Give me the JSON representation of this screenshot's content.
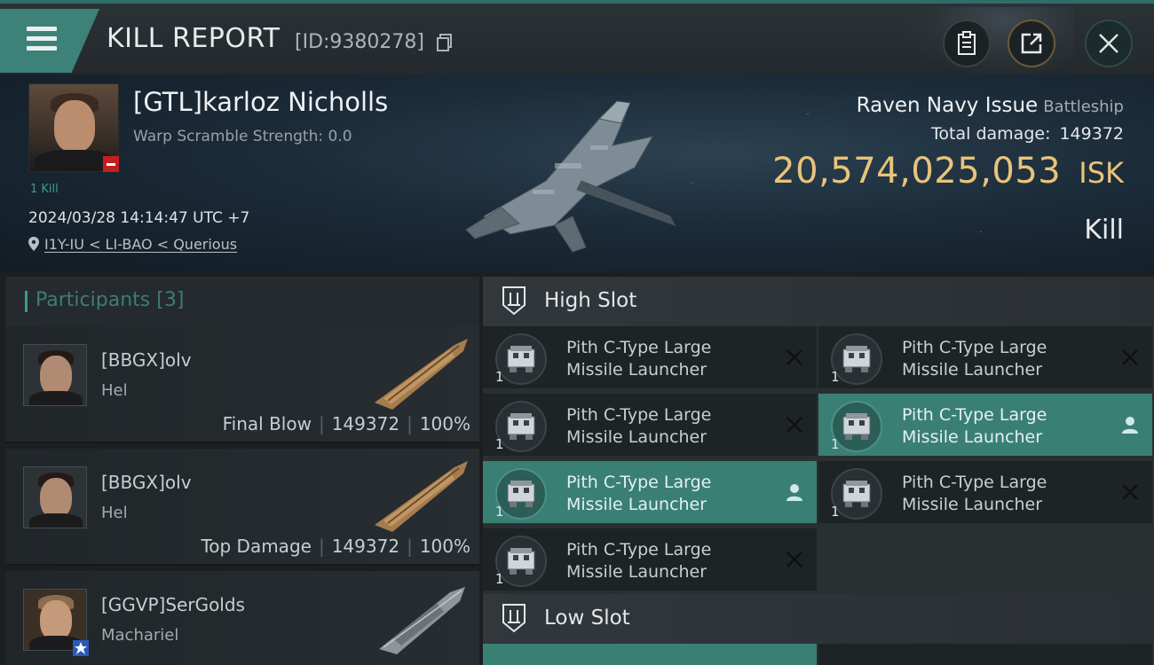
{
  "header": {
    "title": "KILL REPORT",
    "kill_id": "[ID:9380278]"
  },
  "victim": {
    "name": "[GTL]karloz Nicholls",
    "warp_scramble": "Warp Scramble Strength: 0.0",
    "kill_count": "1 Kill",
    "datetime": "2024/03/28 14:14:47 UTC +7",
    "location": "I1Y-IU < LI-BAO < Querious",
    "ship_name": "Raven Navy Issue",
    "ship_class": "Battleship",
    "total_damage_label": "Total damage:",
    "total_damage": "149372",
    "isk_value": "20,574,025,053",
    "isk_unit": "ISK",
    "type": "Kill"
  },
  "participants": {
    "label": "Participants",
    "count": "[3]",
    "rows": [
      {
        "name": "[BBGX]olv",
        "ship": "Hel",
        "role": "Final Blow",
        "damage": "149372",
        "percent": "100%"
      },
      {
        "name": "[BBGX]olv",
        "ship": "Hel",
        "role": "Top Damage",
        "damage": "149372",
        "percent": "100%"
      },
      {
        "name": "[GGVP]SerGolds",
        "ship": "Machariel"
      }
    ]
  },
  "fitting": {
    "high_slot_label": "High Slot",
    "low_slot_label": "Low Slot",
    "high_modules": [
      {
        "name": "Pith C-Type Large Missile Launcher",
        "qty": "1",
        "status": "destroyed"
      },
      {
        "name": "Pith C-Type Large Missile Launcher",
        "qty": "1",
        "status": "destroyed"
      },
      {
        "name": "Pith C-Type Large Missile Launcher",
        "qty": "1",
        "status": "dropped"
      },
      {
        "name": "Pith C-Type Large Missile Launcher",
        "qty": "1",
        "status": "destroyed"
      },
      {
        "name": "Pith C-Type Large Missile Launcher",
        "qty": "1",
        "status": "destroyed"
      },
      {
        "name": "Pith C-Type Large Missile Launcher",
        "qty": "1",
        "status": "dropped"
      },
      {
        "name": "Pith C-Type Large Missile Launcher",
        "qty": "1",
        "status": "destroyed"
      }
    ]
  },
  "colors": {
    "accent": "#3b9c8e",
    "isk": "#e8c47a",
    "dropped_bg": "#3a7f74"
  },
  "icons": [
    "menu-icon",
    "copy-icon",
    "report-icon",
    "share-icon",
    "close-icon",
    "location-pin-icon",
    "slot-icon",
    "launcher-icon",
    "destroyed-x-icon",
    "dropped-person-icon"
  ]
}
